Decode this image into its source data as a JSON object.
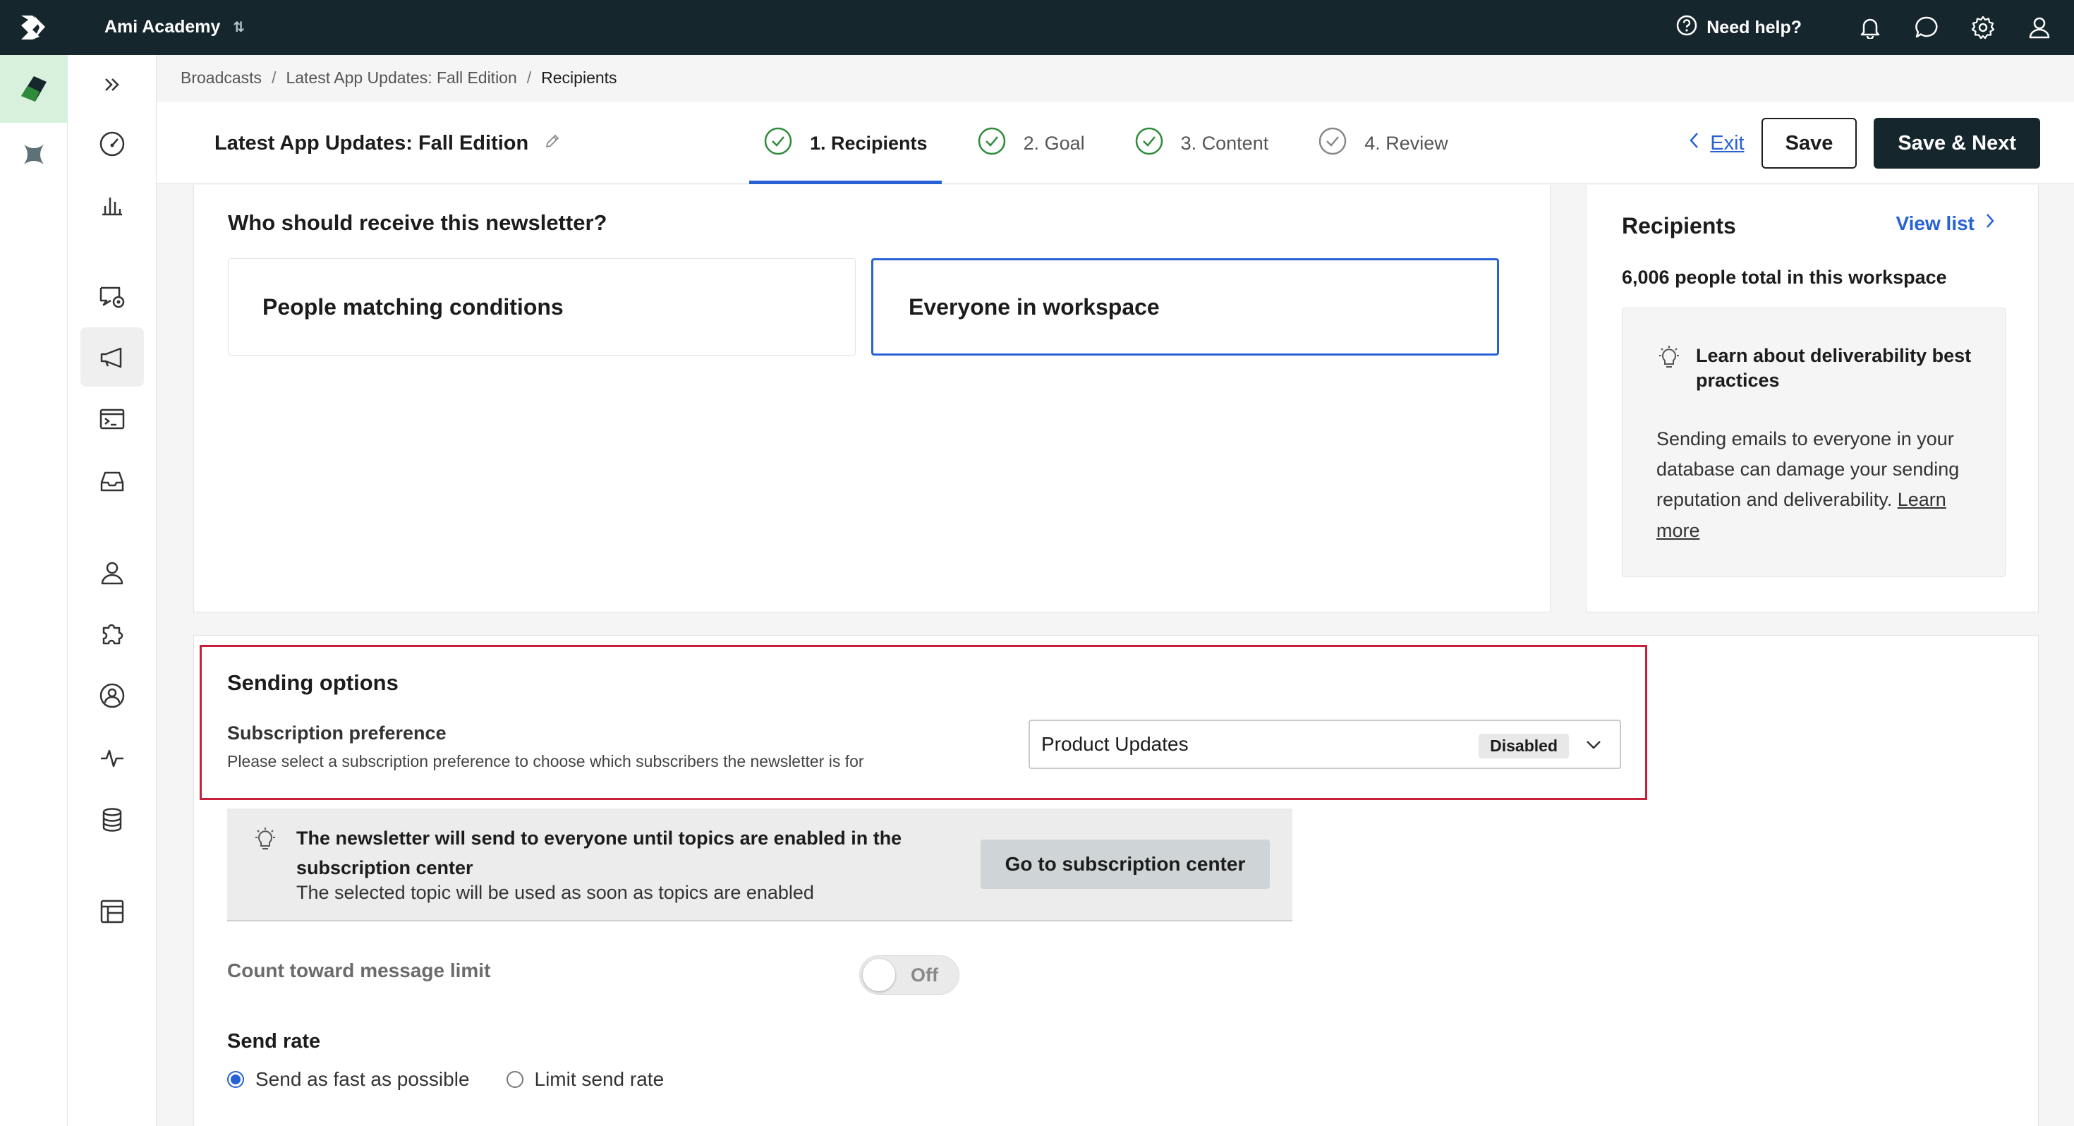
{
  "topbar": {
    "workspace": "Ami Academy",
    "help_label": "Need help?"
  },
  "breadcrumb": {
    "items": [
      "Broadcasts",
      "Latest App Updates: Fall Edition",
      "Recipients"
    ],
    "separator": "/"
  },
  "header": {
    "title": "Latest App Updates: Fall Edition",
    "steps": [
      {
        "label": "1. Recipients",
        "current": true
      },
      {
        "label": "2. Goal",
        "current": false
      },
      {
        "label": "3. Content",
        "current": false
      },
      {
        "label": "4. Review",
        "current": false
      }
    ],
    "exit_label": "Exit",
    "save_label": "Save",
    "save_next_label": "Save & Next"
  },
  "recipients_card": {
    "heading": "Who should receive this newsletter?",
    "option_conditions": "People matching conditions",
    "option_everyone": "Everyone in workspace",
    "selected": "Everyone in workspace"
  },
  "side_panel": {
    "title": "Recipients",
    "view_list_label": "View list",
    "total": "6,006 people total in this workspace",
    "tip_title": "Learn about deliverability best practices",
    "tip_body": "Sending emails to everyone in your database can damage your sending reputation and deliverability.",
    "tip_link": "Learn more"
  },
  "sending_options": {
    "title": "Sending options",
    "pref_label": "Subscription preference",
    "pref_desc": "Please select a subscription preference to choose which subscribers the newsletter is for",
    "select_value": "Product Updates",
    "select_badge": "Disabled",
    "info_head": "The newsletter will send to everyone until topics are enabled in the subscription center",
    "info_sub": "The selected topic will be used as soon as topics are enabled",
    "info_button": "Go to subscription center",
    "count_label": "Count toward message limit",
    "toggle_label": "Off",
    "rate_label": "Send rate",
    "rate_options": [
      "Send as fast as possible",
      "Limit send rate"
    ],
    "rate_selected": "Send as fast as possible"
  },
  "colors": {
    "topbar": "#16262d",
    "accent": "#2762d4",
    "highlight": "#c8203c",
    "step_check": "#2e8b3a"
  }
}
